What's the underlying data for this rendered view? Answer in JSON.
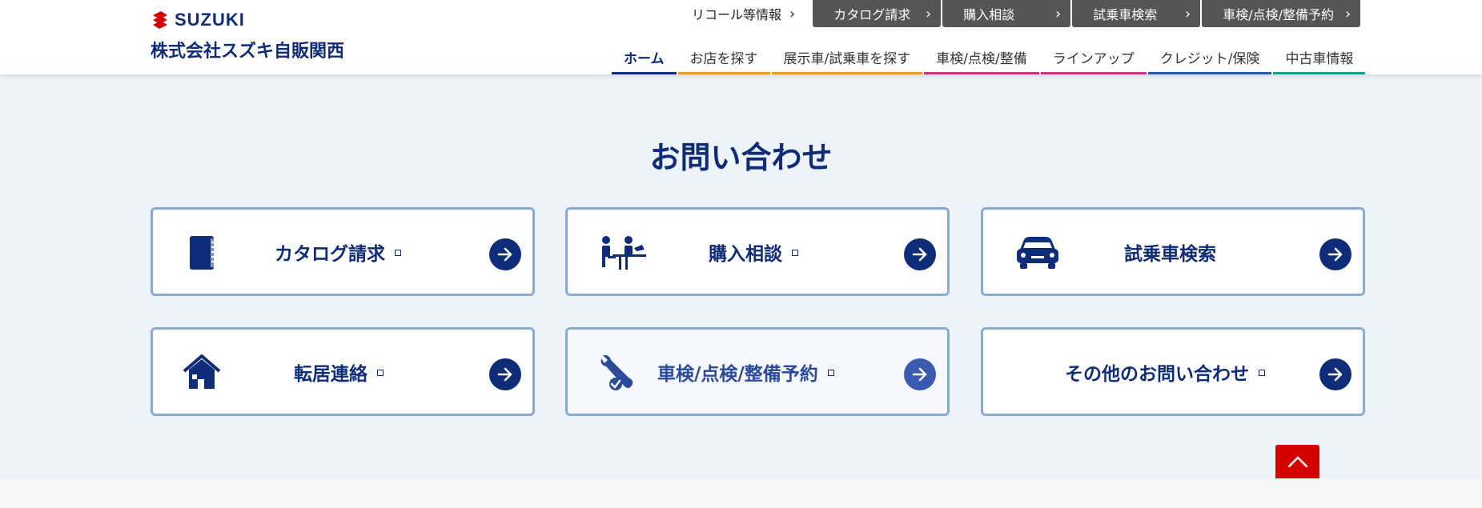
{
  "brand": {
    "logo_text": "SUZUKI",
    "company": "株式会社スズキ自販関西"
  },
  "topbar": {
    "recall": "リコール等情報",
    "buttons": [
      "カタログ請求",
      "購入相談",
      "試乗車検索",
      "車検/点検/整備予約"
    ]
  },
  "nav": [
    {
      "label": "ホーム",
      "color": "#0f2c78"
    },
    {
      "label": "お店を探す",
      "color": "#e8a020"
    },
    {
      "label": "展示車/試乗車を探す",
      "color": "#e8a020"
    },
    {
      "label": "車検/点検/整備",
      "color": "#c8308a"
    },
    {
      "label": "ラインアップ",
      "color": "#c8308a"
    },
    {
      "label": "クレジット/保険",
      "color": "#1a5fa8"
    },
    {
      "label": "中古車情報",
      "color": "#1a9a90"
    }
  ],
  "contact": {
    "title": "お問い合わせ",
    "cards": [
      {
        "label": "カタログ請求",
        "icon": "catalog-book-icon"
      },
      {
        "label": "購入相談",
        "icon": "consultation-people-icon"
      },
      {
        "label": "試乗車検索",
        "icon": "car-icon"
      },
      {
        "label": "転居連絡",
        "icon": "house-icon"
      },
      {
        "label": "車検/点検/整備予約",
        "icon": "wrench-check-icon"
      },
      {
        "label": "その他のお問い合わせ",
        "icon": ""
      }
    ]
  },
  "colors": {
    "brand": "#0f2c78",
    "section_bg": "#eef3fa",
    "card_border": "#8aaad6",
    "pagetop": "#d40000"
  }
}
